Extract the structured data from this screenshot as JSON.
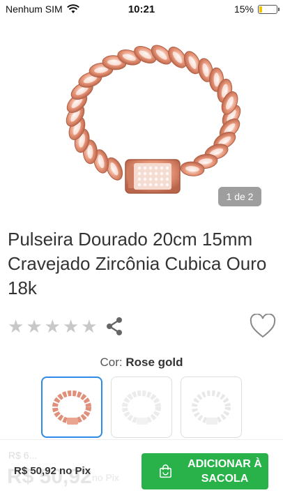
{
  "status_bar": {
    "carrier": "Nenhum SIM",
    "time": "10:21",
    "battery": "15%",
    "battery_level": 0.15
  },
  "gallery": {
    "counter": "1 de 2"
  },
  "product": {
    "title": "Pulseira Dourado 20cm 15mm Cravejado Zircônia Cubica Ouro 18k",
    "rating_stars": 5,
    "rating_filled": 0
  },
  "variant": {
    "label": "Cor:",
    "selected": "Rose gold"
  },
  "bottom_bar": {
    "ghost_old_price": "R$ 6...",
    "ghost_price": "R$ 50,92",
    "ghost_pix": "no Pix",
    "pix_price": "R$ 50,92 no Pix",
    "add_to_cart": "ADICIONAR À SACOLA"
  },
  "colors": {
    "accent": "#2ab24a",
    "selected_border": "#2e89e8",
    "rose_gold": "#e8967a"
  }
}
